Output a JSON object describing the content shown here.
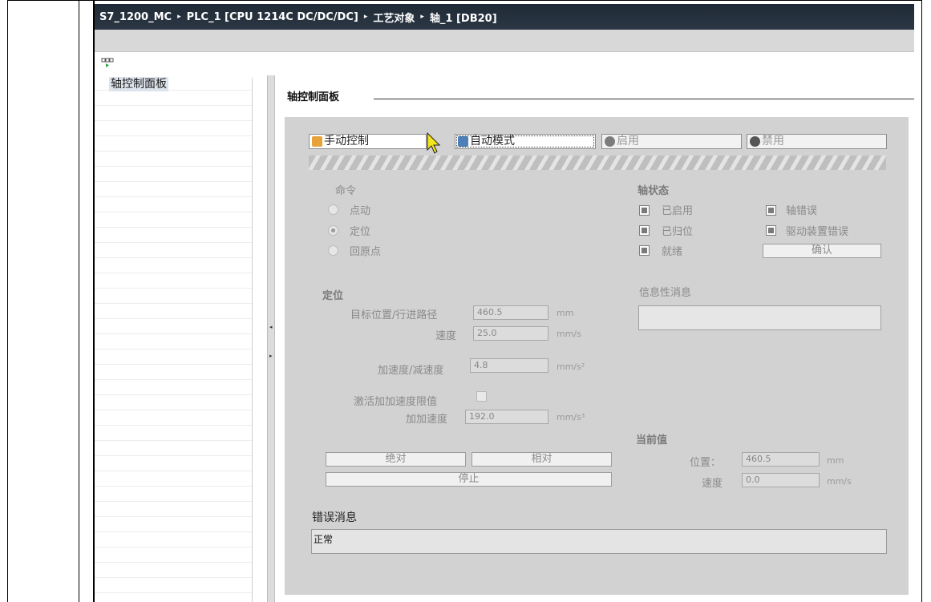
{
  "breadcrumb": {
    "items": [
      "S7_1200_MC",
      "PLC_1 [CPU 1214C DC/DC/DC]",
      "工艺对象",
      "轴_1 [DB20]"
    ],
    "separator": "▸"
  },
  "tree": {
    "items": [
      {
        "label": "轴控制面板"
      }
    ]
  },
  "main": {
    "heading": "轴控制面板",
    "toolbar": {
      "manual": "手动控制",
      "auto": "自动模式",
      "enable": "启用",
      "disable": "禁用"
    },
    "command": {
      "title": "命令",
      "options": [
        "点动",
        "定位",
        "回原点"
      ],
      "selected": "定位"
    },
    "axis_status": {
      "title": "轴状态",
      "enabled": "已启用",
      "homed": "已归位",
      "ready": "就绪",
      "axis_error": "轴错误",
      "drive_error": "驱动装置错误",
      "ack_button": "确认"
    },
    "info": {
      "title": "信息性消息"
    },
    "positioning": {
      "title": "定位",
      "target_label": "目标位置/行进路径",
      "target_value": "460.5",
      "target_unit": "mm",
      "speed_label": "速度",
      "speed_value": "25.0",
      "speed_unit": "mm/s",
      "accel_label": "加速度/减速度",
      "accel_value": "4.8",
      "accel_unit": "mm/s²",
      "jerk_enable_label": "激活加加速度限值",
      "jerk_label": "加加速度",
      "jerk_value": "192.0",
      "jerk_unit": "mm/s³"
    },
    "buttons": {
      "absolute": "绝对",
      "relative": "相对",
      "stop": "停止"
    },
    "current": {
      "title": "当前值",
      "position_label": "位置：",
      "position_value": "460.5",
      "position_unit": "mm",
      "speed_label": "速度",
      "speed_value": "0.0",
      "speed_unit": "mm/s"
    },
    "error": {
      "title": "错误消息",
      "text": "正常"
    }
  },
  "colors": {
    "titlebar": "#1f2a36",
    "panel": "#d2d2d2",
    "disabled_text": "#8a8a8a"
  },
  "icons": [
    "axis-panel-icon",
    "hand-icon",
    "auto-mode-icon",
    "enable-icon",
    "disable-icon",
    "mouse-cursor-icon"
  ]
}
